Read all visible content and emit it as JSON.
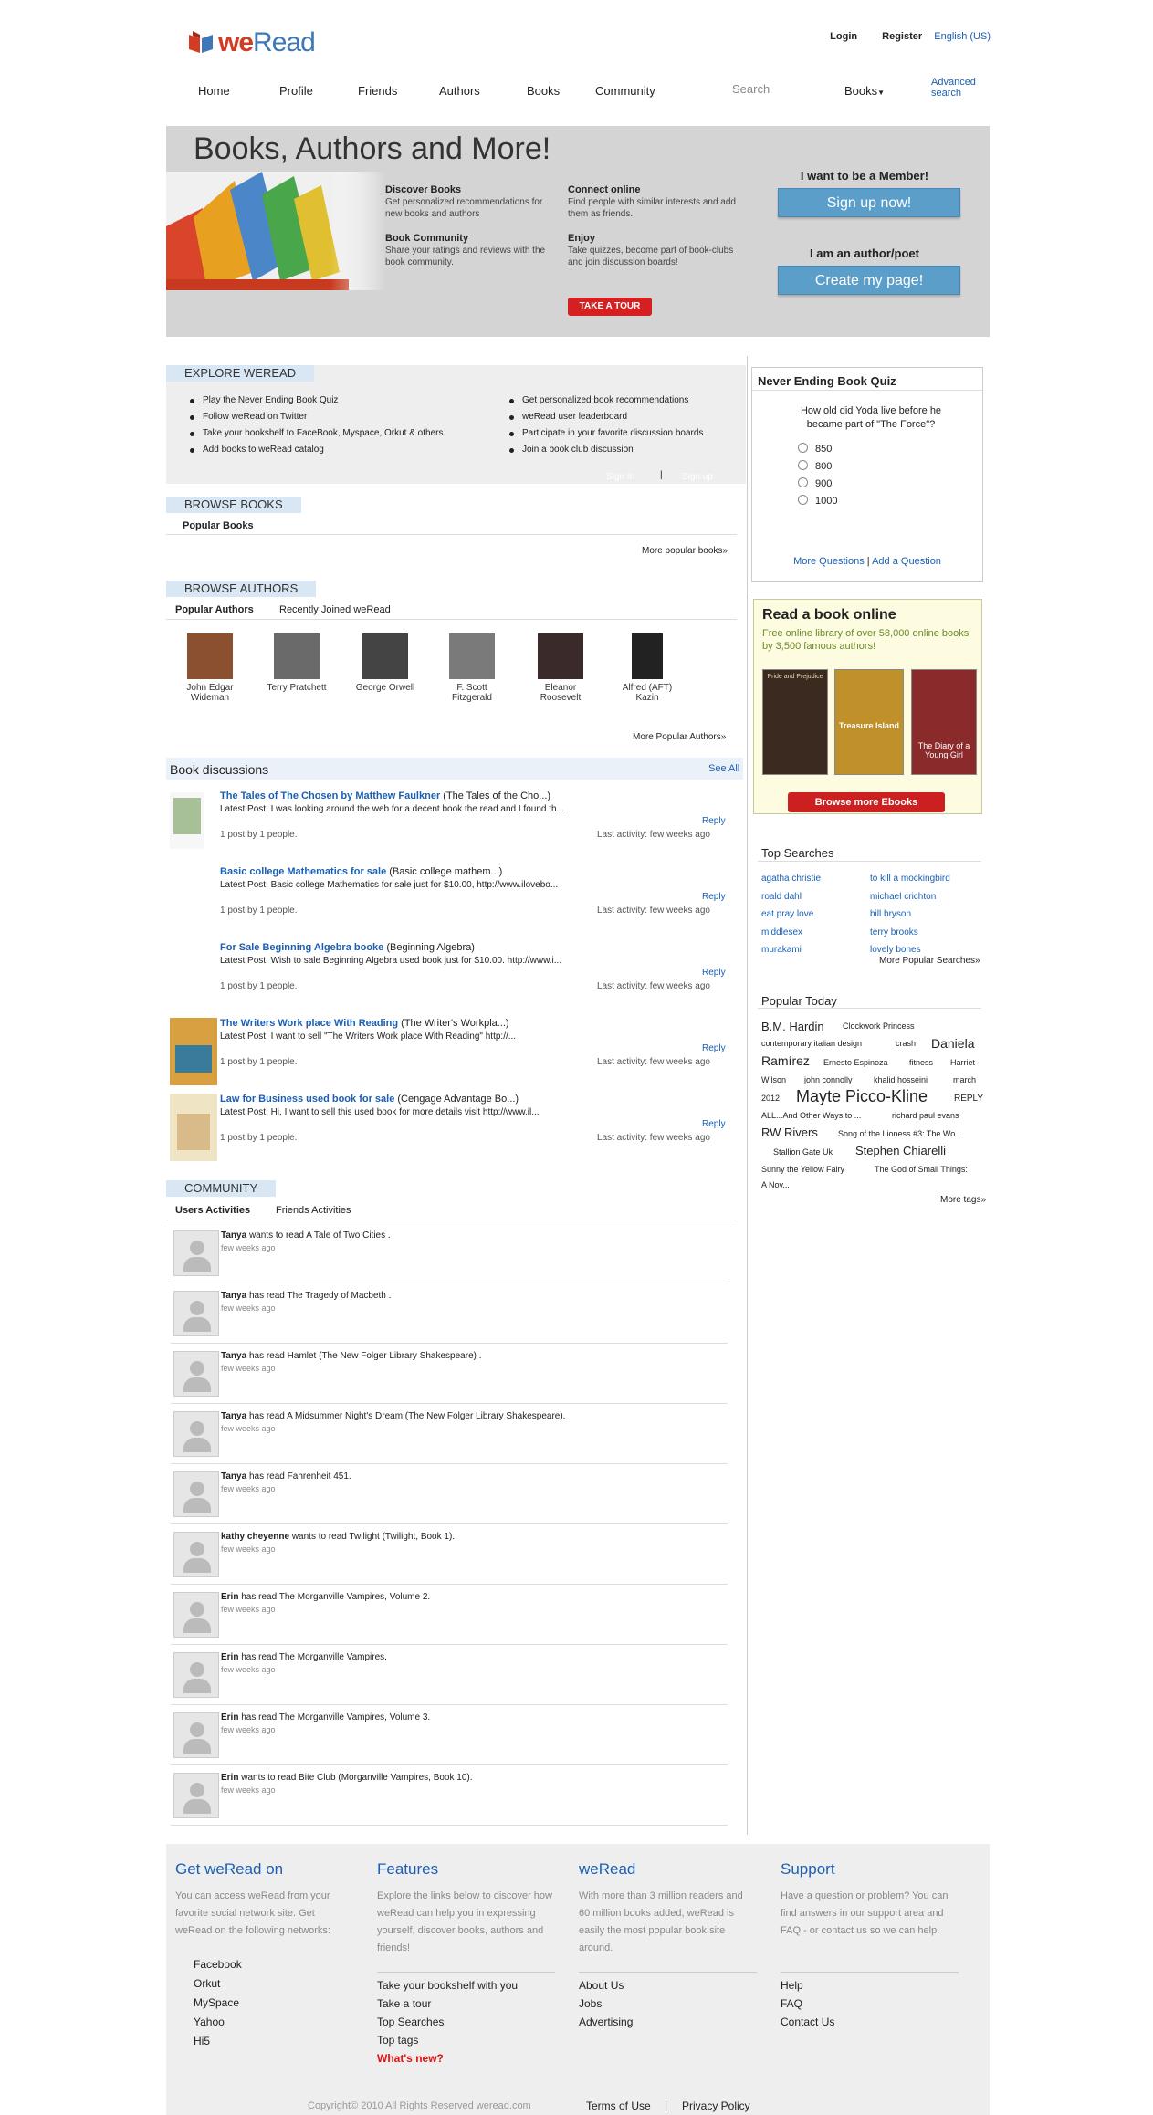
{
  "header": {
    "logo_we": "we",
    "logo_read": "Read",
    "login": "Login",
    "register": "Register",
    "language": "English (US)"
  },
  "nav": {
    "items": [
      "Home",
      "Profile",
      "Friends",
      "Authors",
      "Books",
      "Community"
    ],
    "search_placeholder": "Search",
    "search_scope": "Books",
    "advanced_search": "Advanced search"
  },
  "hero": {
    "title": "Books, Authors and More!",
    "features": [
      {
        "title": "Discover Books",
        "text": "Get personalized recommendations for new books and authors"
      },
      {
        "title": "Connect online",
        "text": "Find people with similar interests and add them as friends."
      },
      {
        "title": "Book Community",
        "text": "Share your ratings and reviews with the book community."
      },
      {
        "title": "Enjoy",
        "text": "Take quizzes, become part of book-clubs and join discussion boards!"
      }
    ],
    "tour": "TAKE A TOUR",
    "member_q": "I want to be a Member!",
    "signup": "Sign up now!",
    "author_q": "I am an author/poet",
    "create": "Create my page!"
  },
  "explore": {
    "heading": "EXPLORE WEREAD",
    "left": [
      "Play the Never Ending Book Quiz",
      "Follow weRead on Twitter",
      "Take your bookshelf to FaceBook, Myspace, Orkut & others",
      "Add books to weRead catalog"
    ],
    "right": [
      "Get personalized book recommendations",
      "weRead user leaderboard",
      "Participate in your favorite discussion boards",
      "Join a book club discussion"
    ],
    "signin": "Sign In",
    "signup": "Sign up"
  },
  "browse_books": {
    "heading": "BROWSE BOOKS",
    "tab": "Popular Books",
    "more": "More popular books»"
  },
  "browse_authors": {
    "heading": "BROWSE AUTHORS",
    "tabs": [
      "Popular Authors",
      "Recently Joined weRead"
    ],
    "authors": [
      "John Edgar Wideman",
      "Terry Pratchett",
      "George Orwell",
      "F. Scott Fitzgerald",
      "Eleanor Roosevelt",
      "Alfred (AFT) Kazin"
    ],
    "more": "More Popular Authors»"
  },
  "discussions": {
    "heading": "Book discussions",
    "see_all": "See All",
    "reply": "Reply",
    "posts": "1 post by 1 people.",
    "activity": "Last activity: few weeks ago",
    "items": [
      {
        "title": "The Tales of The Chosen by Matthew Faulkner",
        "book": " (The Tales of the Cho...)",
        "post": "Latest Post: I was looking around the web for a decent book the read and I found th..."
      },
      {
        "title": "Basic college Mathematics for sale",
        "book": " (Basic college mathem...)",
        "post": "Latest Post: Basic college Mathematics for sale just for $10.00, http://www.ilovebo..."
      },
      {
        "title": "For Sale Beginning Algebra booke",
        "book": " (Beginning Algebra)",
        "post": "Latest Post: Wish to sale Beginning Algebra used book just for $10.00. http://www.i..."
      },
      {
        "title": "The Writers Work place With Reading",
        "book": " (The Writer's Workpla...)",
        "post": "Latest Post: I want to sell \"The Writers Work place With Reading\" http://..."
      },
      {
        "title": "Law for Business used book for sale",
        "book": " (Cengage Advantage Bo...)",
        "post": "Latest Post: Hi, I want to sell this used book for more details visit http://www.il..."
      }
    ]
  },
  "community": {
    "heading": "COMMUNITY",
    "tabs": [
      "Users Activities",
      "Friends Activities"
    ],
    "time": "few weeks ago",
    "items": [
      {
        "user": "Tanya",
        "verb": " wants to read ",
        "book": "A Tale of Two Cities ."
      },
      {
        "user": "Tanya",
        "verb": " has read ",
        "book": "The Tragedy of Macbeth ."
      },
      {
        "user": "Tanya",
        "verb": " has read ",
        "book": "Hamlet (The New Folger Library Shakespeare) ."
      },
      {
        "user": "Tanya",
        "verb": " has read ",
        "book": "A Midsummer Night's Dream (The New Folger Library Shakespeare)."
      },
      {
        "user": "Tanya",
        "verb": " has read ",
        "book": "Fahrenheit 451."
      },
      {
        "user": "kathy cheyenne",
        "verb": " wants to read ",
        "book": "Twilight (Twilight, Book 1)."
      },
      {
        "user": "Erin",
        "verb": " has read ",
        "book": "The Morganville Vampires, Volume 2."
      },
      {
        "user": "Erin",
        "verb": " has read ",
        "book": "The Morganville Vampires."
      },
      {
        "user": "Erin",
        "verb": " has read ",
        "book": "The Morganville Vampires, Volume 3."
      },
      {
        "user": "Erin",
        "verb": " wants to read ",
        "book": "Bite Club (Morganville Vampires, Book 10)."
      }
    ]
  },
  "quiz": {
    "heading": "Never Ending Book Quiz",
    "question": "How old did Yoda live before he became part of \"The Force\"?",
    "options": [
      "850",
      "800",
      "900",
      "1000"
    ],
    "more": "More Questions",
    "add": "Add a Question"
  },
  "read_online": {
    "heading": "Read a book online",
    "text": "Free online library of over 58,000 online books by 3,500 famous authors!",
    "button": "Browse more Ebooks",
    "covers": [
      "Pride and Prejudice",
      "Treasure Island",
      "The Diary of a Young Girl"
    ]
  },
  "top_searches": {
    "heading": "Top Searches",
    "left": [
      "agatha christie",
      "roald dahl",
      "eat pray love",
      "middlesex",
      "murakami"
    ],
    "right": [
      "to kill a mockingbird",
      "michael crichton",
      "bill bryson",
      "terry brooks",
      "lovely bones"
    ],
    "more": "More Popular Searches»"
  },
  "popular_today": {
    "heading": "Popular Today",
    "more": "More tags»",
    "tags": [
      "B.M. Hardin",
      "Clockwork Princess",
      "contemporary italian design",
      "crash",
      "Daniela",
      "Ramírez",
      "Ernesto Espinoza",
      "fitness",
      "Harriet",
      "Wilson",
      "john connolly",
      "khalid hosseini",
      "march",
      "2012",
      "Mayte Picco-Kline",
      "REPLY",
      "ALL...And Other Ways to ...",
      "richard paul evans",
      "RW Rivers",
      "Song of the Lioness #3: The Wo...",
      "Stallion Gate Uk",
      "Stephen Chiarelli",
      "Sunny the Yellow Fairy",
      "The God of Small Things:",
      "A Nov..."
    ]
  },
  "footer": {
    "cols": [
      {
        "title": "Get weRead on",
        "text": "You can access weRead from your favorite social network site. Get weRead on the following networks:",
        "links": [
          "Facebook",
          "Orkut",
          "MySpace",
          "Yahoo",
          "Hi5"
        ]
      },
      {
        "title": "Features",
        "text": "Explore the links below to discover how weRead can help you in expressing yourself, discover books, authors and friends!",
        "links": [
          "Take your bookshelf with you",
          "Take a tour",
          "Top Searches",
          "Top tags"
        ],
        "new": "What's new?"
      },
      {
        "title": "weRead",
        "text": "With more than 3 million readers and 60 million books added, weRead is easily the most popular book site around.",
        "links": [
          "About Us",
          "Jobs",
          "Advertising"
        ]
      },
      {
        "title": "Support",
        "text": "Have a question or problem? You can find answers in our support area and FAQ - or contact us so we can help.",
        "links": [
          "Help",
          "FAQ",
          "Contact Us"
        ]
      }
    ],
    "copyright": "Copyright© 2010 All Rights Reserved weread.com",
    "terms": "Terms of Use",
    "privacy": "Privacy Policy"
  },
  "colors": {
    "brand_blue": "#3e78b7",
    "brand_red": "#d33b22",
    "link": "#1a5fb4",
    "button_blue": "#5b9ec9",
    "tour_red": "#d42020"
  }
}
